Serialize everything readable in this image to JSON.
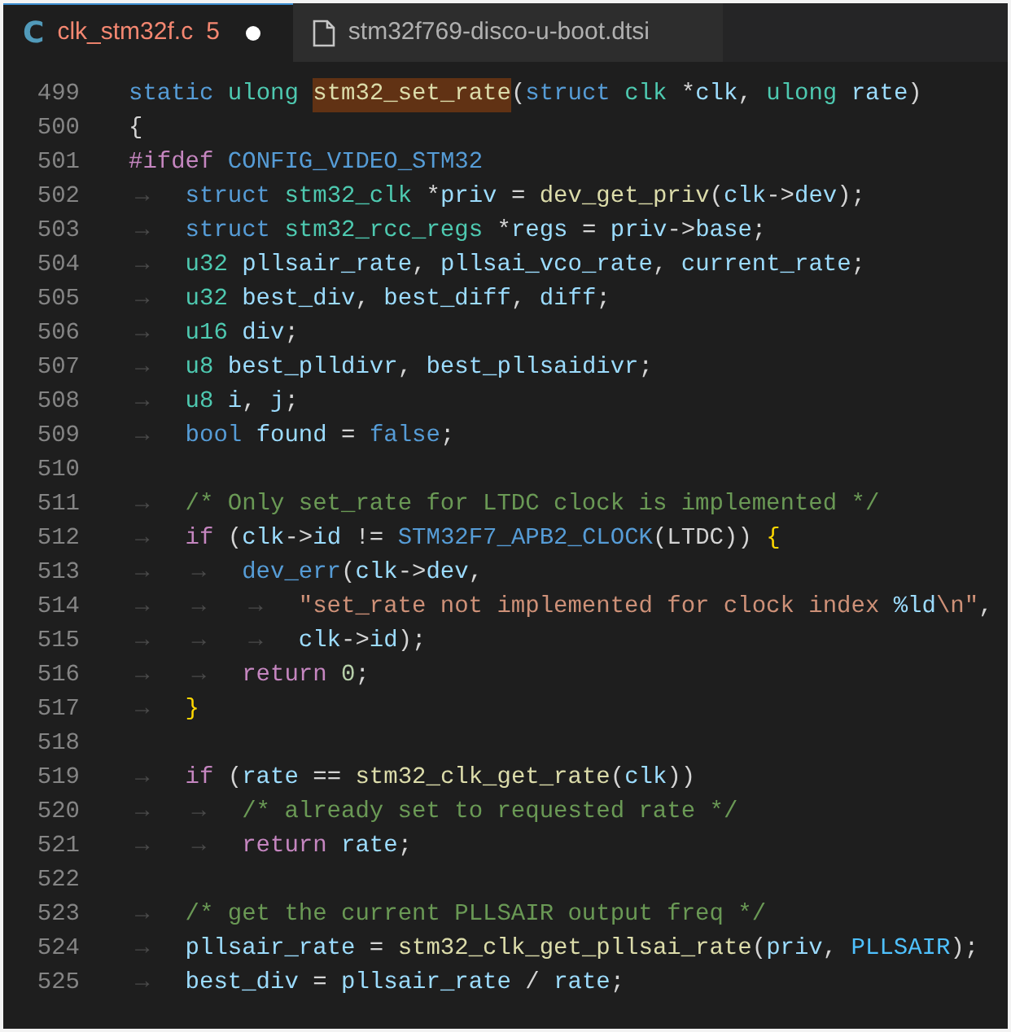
{
  "tabs": [
    {
      "kind": "language",
      "icon_text": "C",
      "label": "clk_stm32f.c",
      "problems": "5",
      "modified": true,
      "selected": true,
      "error": true
    },
    {
      "kind": "file",
      "label": "stm32f769-disco-u-boot.dtsi",
      "modified": false,
      "selected": false,
      "error": false
    }
  ],
  "editor": {
    "lines": [
      {
        "number": "499",
        "tokens": [
          {
            "kind": "kw",
            "text": "static "
          },
          {
            "kind": "type",
            "text": "ulong "
          },
          {
            "kind": "fn",
            "text": "stm32_set_rate",
            "highlighted": true
          },
          {
            "kind": "punc",
            "text": "("
          },
          {
            "kind": "kw",
            "text": "struct "
          },
          {
            "kind": "type",
            "text": "clk "
          },
          {
            "kind": "punc",
            "text": "*"
          },
          {
            "kind": "var",
            "text": "clk"
          },
          {
            "kind": "punc",
            "text": ", "
          },
          {
            "kind": "type",
            "text": "ulong "
          },
          {
            "kind": "var",
            "text": "rate"
          },
          {
            "kind": "punc",
            "text": ")"
          }
        ]
      },
      {
        "number": "500",
        "tokens": [
          {
            "kind": "punc",
            "text": "{"
          }
        ]
      },
      {
        "number": "501",
        "tokens": [
          {
            "kind": "ctrl",
            "text": "#ifdef "
          },
          {
            "kind": "kw",
            "text": "CONFIG_VIDEO_STM32"
          }
        ]
      },
      {
        "number": "502",
        "indent": [
          "→"
        ],
        "tokens": [
          {
            "kind": "kw",
            "text": "struct "
          },
          {
            "kind": "type",
            "text": "stm32_clk "
          },
          {
            "kind": "punc",
            "text": "*"
          },
          {
            "kind": "var",
            "text": "priv"
          },
          {
            "kind": "punc",
            "text": " = "
          },
          {
            "kind": "fn",
            "text": "dev_get_priv"
          },
          {
            "kind": "punc",
            "text": "("
          },
          {
            "kind": "var",
            "text": "clk"
          },
          {
            "kind": "punc",
            "text": "->"
          },
          {
            "kind": "var",
            "text": "dev"
          },
          {
            "kind": "punc",
            "text": ");"
          }
        ]
      },
      {
        "number": "503",
        "indent": [
          "→"
        ],
        "tokens": [
          {
            "kind": "kw",
            "text": "struct "
          },
          {
            "kind": "type",
            "text": "stm32_rcc_regs "
          },
          {
            "kind": "punc",
            "text": "*"
          },
          {
            "kind": "var",
            "text": "regs"
          },
          {
            "kind": "punc",
            "text": " = "
          },
          {
            "kind": "var",
            "text": "priv"
          },
          {
            "kind": "punc",
            "text": "->"
          },
          {
            "kind": "var",
            "text": "base"
          },
          {
            "kind": "punc",
            "text": ";"
          }
        ]
      },
      {
        "number": "504",
        "indent": [
          "→"
        ],
        "tokens": [
          {
            "kind": "type",
            "text": "u32 "
          },
          {
            "kind": "var",
            "text": "pllsair_rate"
          },
          {
            "kind": "punc",
            "text": ", "
          },
          {
            "kind": "var",
            "text": "pllsai_vco_rate"
          },
          {
            "kind": "punc",
            "text": ", "
          },
          {
            "kind": "var",
            "text": "current_rate"
          },
          {
            "kind": "punc",
            "text": ";"
          }
        ]
      },
      {
        "number": "505",
        "indent": [
          "→"
        ],
        "tokens": [
          {
            "kind": "type",
            "text": "u32 "
          },
          {
            "kind": "var",
            "text": "best_div"
          },
          {
            "kind": "punc",
            "text": ", "
          },
          {
            "kind": "var",
            "text": "best_diff"
          },
          {
            "kind": "punc",
            "text": ", "
          },
          {
            "kind": "var",
            "text": "diff"
          },
          {
            "kind": "punc",
            "text": ";"
          }
        ]
      },
      {
        "number": "506",
        "indent": [
          "→"
        ],
        "tokens": [
          {
            "kind": "type",
            "text": "u16 "
          },
          {
            "kind": "var",
            "text": "div"
          },
          {
            "kind": "punc",
            "text": ";"
          }
        ]
      },
      {
        "number": "507",
        "indent": [
          "→"
        ],
        "tokens": [
          {
            "kind": "type",
            "text": "u8 "
          },
          {
            "kind": "var",
            "text": "best_plldivr"
          },
          {
            "kind": "punc",
            "text": ", "
          },
          {
            "kind": "var",
            "text": "best_pllsaidivr"
          },
          {
            "kind": "punc",
            "text": ";"
          }
        ]
      },
      {
        "number": "508",
        "indent": [
          "→"
        ],
        "tokens": [
          {
            "kind": "type",
            "text": "u8 "
          },
          {
            "kind": "var",
            "text": "i"
          },
          {
            "kind": "punc",
            "text": ", "
          },
          {
            "kind": "var",
            "text": "j"
          },
          {
            "kind": "punc",
            "text": ";"
          }
        ]
      },
      {
        "number": "509",
        "indent": [
          "→"
        ],
        "tokens": [
          {
            "kind": "kw",
            "text": "bool "
          },
          {
            "kind": "var",
            "text": "found"
          },
          {
            "kind": "punc",
            "text": " = "
          },
          {
            "kind": "kw",
            "text": "false"
          },
          {
            "kind": "punc",
            "text": ";"
          }
        ]
      },
      {
        "number": "510"
      },
      {
        "number": "511",
        "indent": [
          "→"
        ],
        "tokens": [
          {
            "kind": "cmt",
            "text": "/* Only set_rate for LTDC clock is implemented */"
          }
        ]
      },
      {
        "number": "512",
        "indent": [
          "→"
        ],
        "tokens": [
          {
            "kind": "ctrl",
            "text": "if "
          },
          {
            "kind": "punc",
            "text": "("
          },
          {
            "kind": "var",
            "text": "clk"
          },
          {
            "kind": "punc",
            "text": "->"
          },
          {
            "kind": "var",
            "text": "id"
          },
          {
            "kind": "punc",
            "text": " != "
          },
          {
            "kind": "kw",
            "text": "STM32F7_APB2_CLOCK"
          },
          {
            "kind": "punc",
            "text": "(LTDC)) "
          },
          {
            "kind": "brace",
            "text": "{"
          }
        ]
      },
      {
        "number": "513",
        "indent": [
          "→",
          "→"
        ],
        "tokens": [
          {
            "kind": "fn2",
            "text": "dev_err"
          },
          {
            "kind": "punc",
            "text": "("
          },
          {
            "kind": "var",
            "text": "clk"
          },
          {
            "kind": "punc",
            "text": "->"
          },
          {
            "kind": "var",
            "text": "dev"
          },
          {
            "kind": "punc",
            "text": ","
          }
        ]
      },
      {
        "number": "514",
        "indent": [
          "→",
          "→",
          "→"
        ],
        "tokens": [
          {
            "kind": "str",
            "text": "\"set_rate not implemented for clock index "
          },
          {
            "kind": "var",
            "text": "%ld"
          },
          {
            "kind": "str",
            "text": "\\n\""
          },
          {
            "kind": "punc",
            "text": ","
          }
        ]
      },
      {
        "number": "515",
        "indent": [
          "→",
          "→",
          "→"
        ],
        "tokens": [
          {
            "kind": "var",
            "text": "clk"
          },
          {
            "kind": "punc",
            "text": "->"
          },
          {
            "kind": "var",
            "text": "id"
          },
          {
            "kind": "punc",
            "text": ");"
          }
        ]
      },
      {
        "number": "516",
        "indent": [
          "→",
          "→"
        ],
        "tokens": [
          {
            "kind": "ctrl",
            "text": "return "
          },
          {
            "kind": "num",
            "text": "0"
          },
          {
            "kind": "punc",
            "text": ";"
          }
        ]
      },
      {
        "number": "517",
        "indent": [
          "→"
        ],
        "tokens": [
          {
            "kind": "brace",
            "text": "}"
          }
        ]
      },
      {
        "number": "518"
      },
      {
        "number": "519",
        "indent": [
          "→"
        ],
        "tokens": [
          {
            "kind": "ctrl",
            "text": "if "
          },
          {
            "kind": "punc",
            "text": "("
          },
          {
            "kind": "var",
            "text": "rate"
          },
          {
            "kind": "punc",
            "text": " == "
          },
          {
            "kind": "fn",
            "text": "stm32_clk_get_rate"
          },
          {
            "kind": "punc",
            "text": "("
          },
          {
            "kind": "var",
            "text": "clk"
          },
          {
            "kind": "punc",
            "text": "))"
          }
        ]
      },
      {
        "number": "520",
        "indent": [
          "→",
          "→"
        ],
        "tokens": [
          {
            "kind": "cmt",
            "text": "/* already set to requested rate */"
          }
        ]
      },
      {
        "number": "521",
        "indent": [
          "→",
          "→"
        ],
        "tokens": [
          {
            "kind": "ctrl",
            "text": "return "
          },
          {
            "kind": "var",
            "text": "rate"
          },
          {
            "kind": "punc",
            "text": ";"
          }
        ]
      },
      {
        "number": "522"
      },
      {
        "number": "523",
        "indent": [
          "→"
        ],
        "tokens": [
          {
            "kind": "cmt",
            "text": "/* get the current PLLSAIR output freq */"
          }
        ]
      },
      {
        "number": "524",
        "indent": [
          "→"
        ],
        "tokens": [
          {
            "kind": "var",
            "text": "pllsair_rate"
          },
          {
            "kind": "punc",
            "text": " = "
          },
          {
            "kind": "fn",
            "text": "stm32_clk_get_pllsai_rate"
          },
          {
            "kind": "punc",
            "text": "("
          },
          {
            "kind": "var",
            "text": "priv"
          },
          {
            "kind": "punc",
            "text": ", "
          },
          {
            "kind": "const",
            "text": "PLLSAIR"
          },
          {
            "kind": "punc",
            "text": ");"
          }
        ]
      },
      {
        "number": "525",
        "indent": [
          "→"
        ],
        "tokens": [
          {
            "kind": "var",
            "text": "best_div"
          },
          {
            "kind": "punc",
            "text": " = "
          },
          {
            "kind": "var",
            "text": "pllsair_rate"
          },
          {
            "kind": "punc",
            "text": " / "
          },
          {
            "kind": "var",
            "text": "rate"
          },
          {
            "kind": "punc",
            "text": ";"
          }
        ]
      }
    ]
  }
}
